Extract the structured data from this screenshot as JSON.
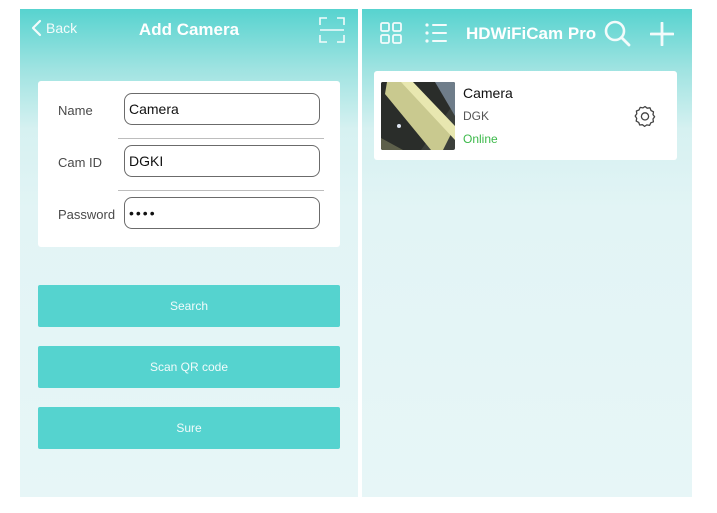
{
  "add_camera": {
    "back_label": "Back",
    "title": "Add Camera",
    "form": {
      "name_label": "Name",
      "name_value": "Camera",
      "camid_label": "Cam ID",
      "camid_value": "DGKI",
      "password_label": "Password",
      "password_value": "••••"
    },
    "buttons": {
      "search": "Search",
      "scan_qr": "Scan QR code",
      "sure": "Sure"
    }
  },
  "camera_list": {
    "title": "HDWiFiCam Pro",
    "cameras": [
      {
        "name": "Camera",
        "id": "DGK",
        "status": "Online",
        "status_color": "#3cb94a"
      }
    ]
  },
  "colors": {
    "accent": "#55d3cf",
    "header_top": "#57d3cf",
    "background": "#e7f6f7"
  },
  "icons": [
    "chevron-left-icon",
    "scan-frame-icon",
    "grid-view-icon",
    "list-view-icon",
    "search-icon",
    "add-icon",
    "settings-gear-icon"
  ]
}
